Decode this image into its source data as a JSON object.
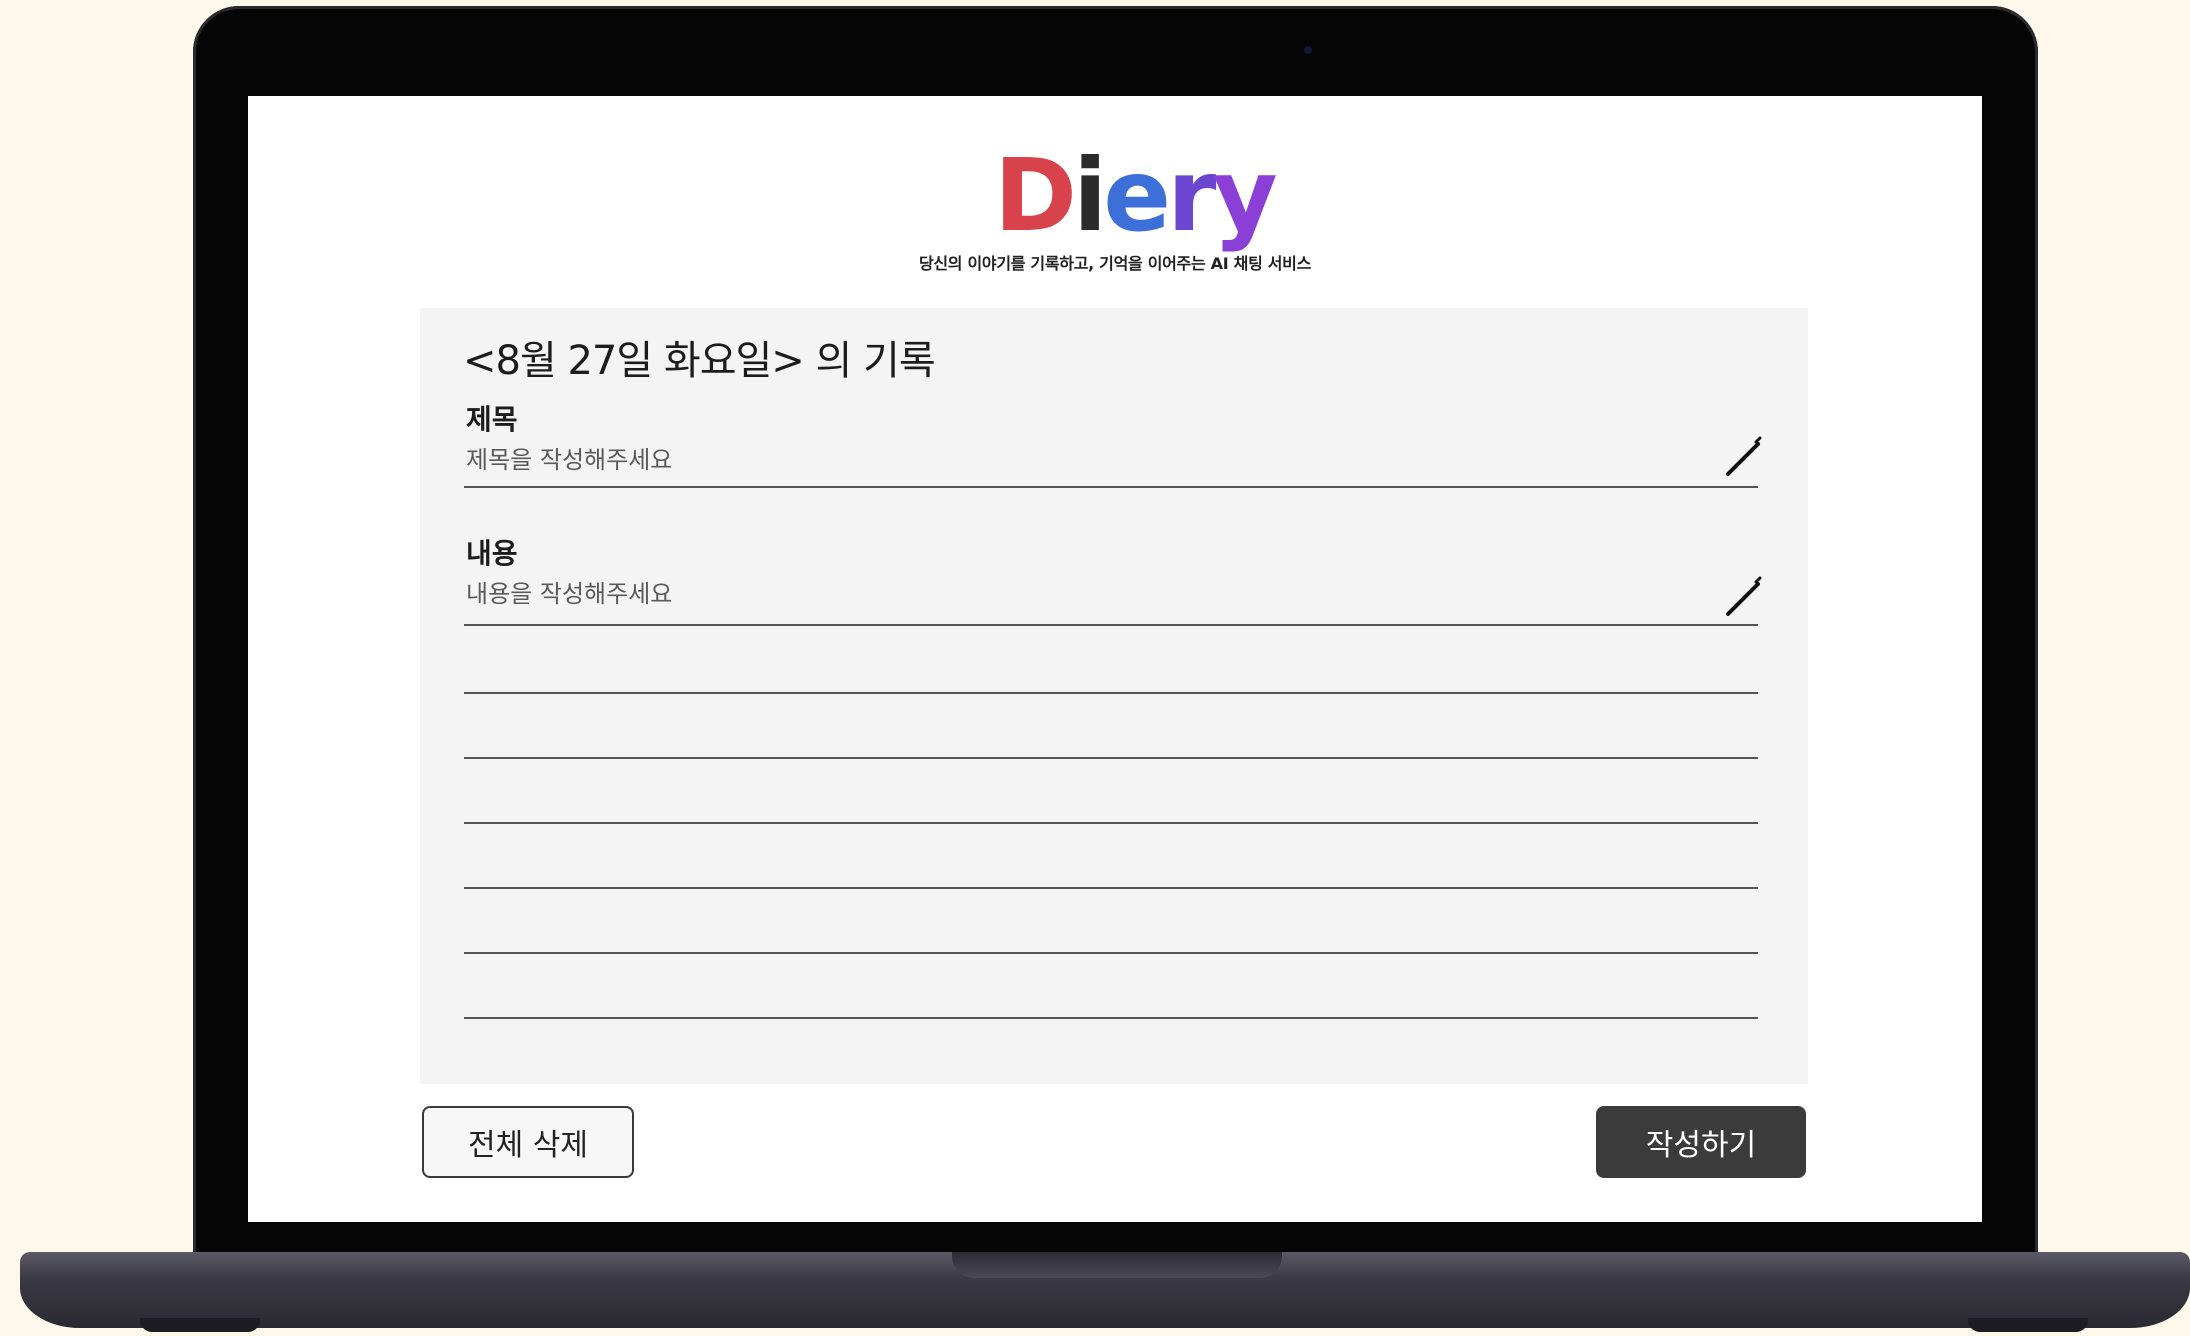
{
  "brand": {
    "logo_letters": [
      "D",
      "i",
      "e",
      "r",
      "y"
    ],
    "tagline": "당신의 이야기를 기록하고, 기억을 이어주는 AI 채팅 서비스"
  },
  "record": {
    "heading": "<8월 27일 화요일> 의 기록",
    "title_field": {
      "label": "제목",
      "placeholder": "제목을 작성해주세요",
      "icon": "pencil-icon"
    },
    "content_field": {
      "label": "내용",
      "placeholder": "내용을 작성해주세요",
      "icon": "pencil-icon"
    }
  },
  "actions": {
    "delete_all_label": "전체 삭제",
    "write_label": "작성하기"
  },
  "colors": {
    "page_background": "#fdf8ea",
    "card_background": "#f4f4f4",
    "primary_button": "#3b3b3b",
    "logo_red": "#d8434b",
    "logo_blue": "#3d6fd8",
    "logo_purple": "#6b46d1"
  }
}
